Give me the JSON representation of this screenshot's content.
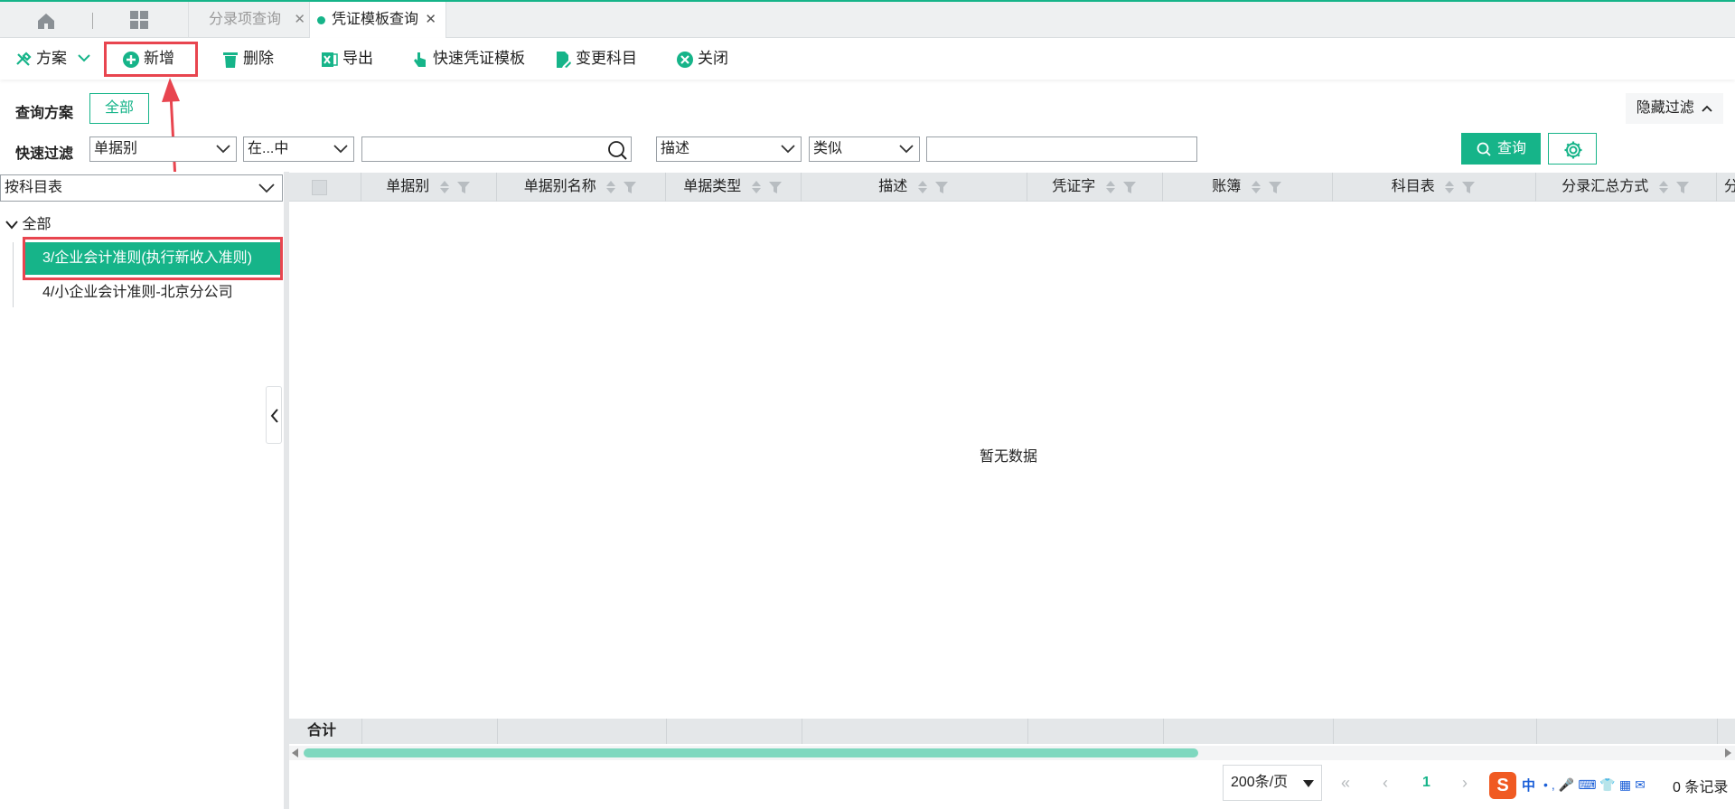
{
  "tabs": [
    {
      "label": "分录项查询"
    },
    {
      "label": "凭证模板查询"
    }
  ],
  "toolbar": {
    "scheme": "方案",
    "add": "新增",
    "delete": "删除",
    "export": "导出",
    "quick_template": "快速凭证模板",
    "change_subject": "变更科目",
    "close": "关闭"
  },
  "filter": {
    "scheme_label": "查询方案",
    "scheme_all": "全部",
    "hide_filter": "隐藏过滤",
    "quick_label": "快速过滤",
    "field1": "单据别",
    "op1": "在...中",
    "value1": "",
    "field2": "描述",
    "op2": "类似",
    "value2": "",
    "query": "查询"
  },
  "tree": {
    "selector": "按科目表",
    "root": "全部",
    "items": [
      {
        "label": "3/企业会计准则(执行新收入准则)",
        "selected": true
      },
      {
        "label": "4/小企业会计准则-北京分公司",
        "selected": false
      }
    ]
  },
  "grid": {
    "columns": [
      "单据别",
      "单据别名称",
      "单据类型",
      "描述",
      "凭证字",
      "账簿",
      "科目表",
      "分录汇总方式",
      "分"
    ],
    "empty_text": "暂无数据",
    "footer_label": "合计"
  },
  "pager": {
    "page_size": "200条/页",
    "current_page": "1",
    "records": "0 条记录"
  },
  "ime": {
    "logo": "S",
    "mode": "中"
  },
  "colors": {
    "accent": "#16b489",
    "highlight": "#e8454f"
  }
}
